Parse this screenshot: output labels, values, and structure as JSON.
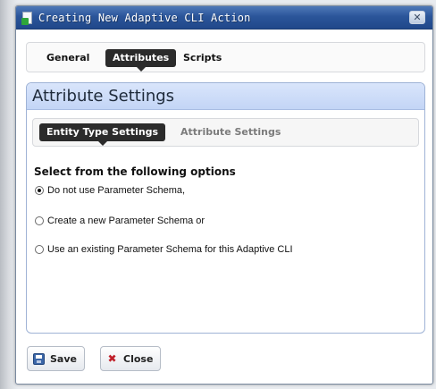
{
  "window": {
    "title": "Creating New Adaptive CLI Action",
    "close_glyph": "✕"
  },
  "tabs": [
    {
      "label": "General",
      "active": false
    },
    {
      "label": "Attributes",
      "active": true
    },
    {
      "label": "Scripts",
      "active": false
    }
  ],
  "panel": {
    "header": "Attribute Settings",
    "subtabs": [
      {
        "label": "Entity Type Settings",
        "active": true
      },
      {
        "label": "Attribute Settings",
        "active": false
      }
    ],
    "options_heading": "Select from the following options",
    "options": [
      {
        "label": "Do not use Parameter Schema,",
        "checked": true
      },
      {
        "label": "Create a new Parameter Schema or",
        "checked": false
      },
      {
        "label": "Use an existing Parameter Schema for this Adaptive CLI",
        "checked": false
      }
    ]
  },
  "footer": {
    "save_label": "Save",
    "close_label": "Close",
    "close_icon_glyph": "✖"
  },
  "icons": {
    "title_icon": "new-document-icon",
    "save_icon": "floppy-disk-icon",
    "close_icon": "red-x-icon"
  },
  "colors": {
    "titlebar": "#2b559a",
    "panel_header": "#c3d5f6",
    "active_tab": "#2b2b2b"
  }
}
